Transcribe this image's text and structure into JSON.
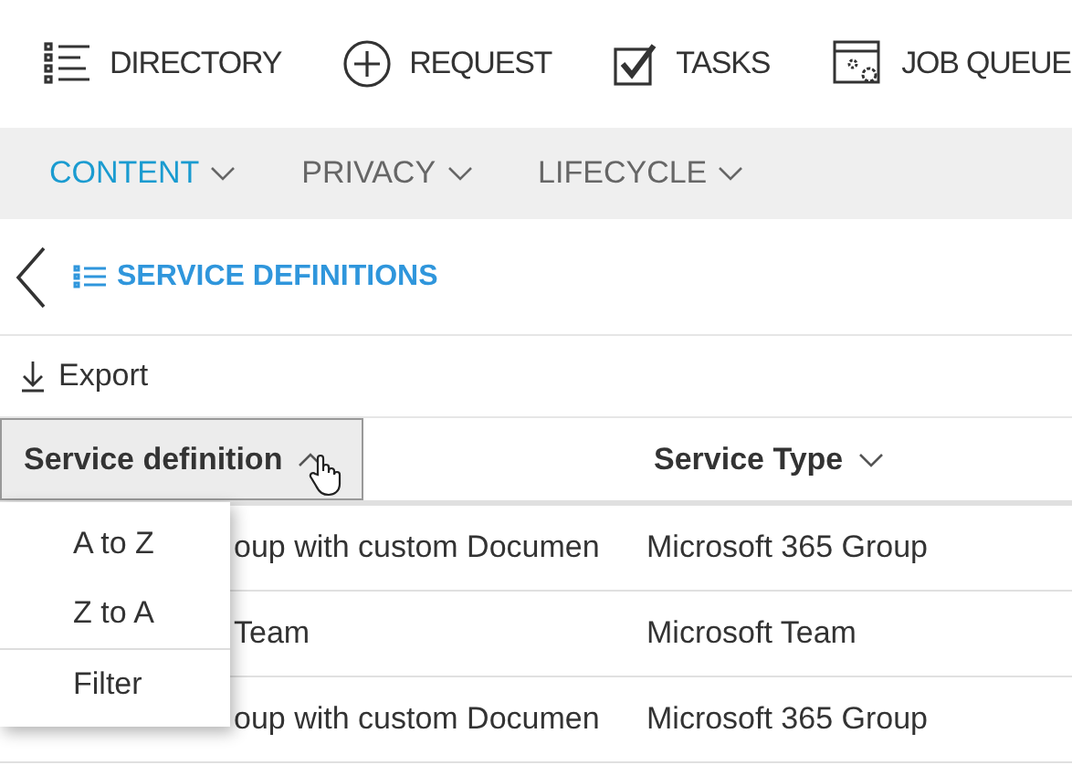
{
  "top_nav": [
    {
      "kind": "directory",
      "label": "DIRECTORY"
    },
    {
      "kind": "request",
      "label": "REQUEST"
    },
    {
      "kind": "tasks",
      "label": "TASKS"
    },
    {
      "kind": "queue",
      "label": "JOB QUEUE"
    }
  ],
  "sub_nav": [
    {
      "label": "CONTENT",
      "selected": true
    },
    {
      "label": "PRIVACY",
      "selected": false
    },
    {
      "label": "LIFECYCLE",
      "selected": false
    }
  ],
  "page_title": "SERVICE DEFINITIONS",
  "export": "Export",
  "table": {
    "columns": [
      {
        "label": "Service definition",
        "active": true
      },
      {
        "label": "Service Type",
        "active": false
      }
    ],
    "rows": [
      {
        "cells": [
          "oup with custom Documen",
          "Microsoft 365 Group"
        ]
      },
      {
        "cells": [
          "Team",
          "Microsoft Team"
        ]
      },
      {
        "cells": [
          "oup with custom Documen",
          "Microsoft 365 Group"
        ]
      }
    ]
  },
  "sort_menu": {
    "items": [
      {
        "label": "A to Z",
        "divider_before": false
      },
      {
        "label": "Z to A",
        "divider_before": false
      },
      {
        "label": "Filter",
        "divider_before": true
      }
    ]
  }
}
